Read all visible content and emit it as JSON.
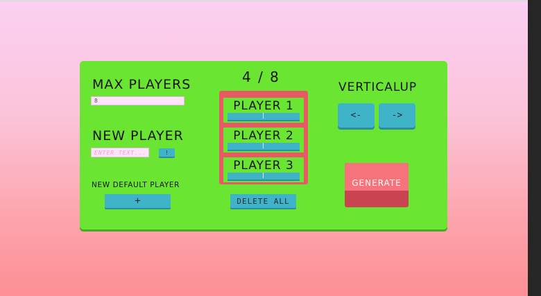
{
  "panel": {
    "max_players": {
      "label": "MAX PLAYERS",
      "value": "8"
    },
    "new_player": {
      "label": "NEW PLAYER",
      "placeholder": "ENTER TEXT...",
      "confirm_label": "!"
    },
    "new_default_player": {
      "label": "NEW DEFAULT PLAYER",
      "add_label": "+"
    },
    "player_count": "4 / 8",
    "players": [
      {
        "name": "PLAYER 1"
      },
      {
        "name": "PLAYER 2"
      },
      {
        "name": "PLAYER 3"
      }
    ],
    "delete_all_label": "DELETE ALL",
    "layout_mode": {
      "label": "VERTICALUP",
      "prev_label": "<-",
      "next_label": "->"
    },
    "generate_label": "GENERATE"
  },
  "colors": {
    "panel": "#6ae632",
    "button": "#3fb3c7",
    "list_frame": "#e85a63",
    "generate": "#f6737b",
    "background_top": "#fbd0f3",
    "background_bottom": "#fd8f95"
  }
}
